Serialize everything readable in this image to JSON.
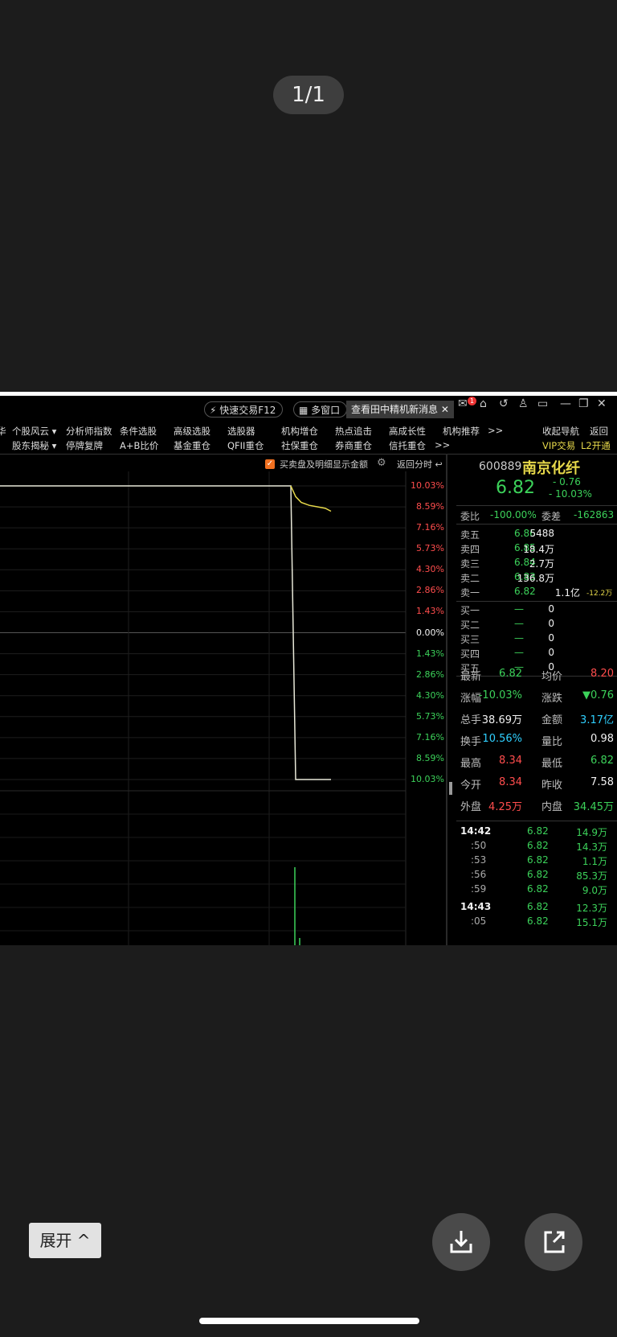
{
  "viewer": {
    "page_counter": "1/1",
    "expand_label": "展开 ^"
  },
  "titlebar": {
    "quick_trade": "快速交易F12",
    "multi_window": "多窗口",
    "tab_label": "查看田中精机新消息",
    "mail_badge": "1"
  },
  "menu": {
    "row1": [
      "个股风云 ▾",
      "分析师指数",
      "条件选股",
      "高级选股",
      "选股器",
      "机构增仓",
      "热点追击",
      "高成长性",
      "机构推荐",
      ">>"
    ],
    "row2": [
      "股东揭秘 ▾",
      "停牌复牌",
      "A+B比价",
      "基金重仓",
      "QFII重仓",
      "社保重仓",
      "券商重仓",
      "信托重仓",
      ">>"
    ],
    "right1": [
      "收起导航",
      "返回"
    ],
    "right2": [
      "VIP交易",
      "L2开通"
    ]
  },
  "chart_header": {
    "checkbox_label": "买卖盘及明细显示金额",
    "back_label": "返回分时"
  },
  "chart_data": {
    "type": "line",
    "ylabel_right": [
      "10.03%",
      "8.59%",
      "7.16%",
      "5.73%",
      "4.30%",
      "2.86%",
      "1.43%",
      "0.00%",
      "1.43%",
      "2.86%",
      "4.30%",
      "5.73%",
      "7.16%",
      "8.59%",
      "10.03%"
    ],
    "ylim_pct": [
      -10.03,
      10.03
    ],
    "price_series_pct": [
      10.03,
      10.03,
      10.03,
      10.03,
      10.03,
      10.03,
      10.03,
      10.03,
      10.03,
      10.03,
      10.03,
      10.03,
      10.03,
      -10.03,
      -10.03,
      -10.03
    ],
    "avg_series_pct": [
      10.03,
      9.3,
      8.9,
      8.7,
      8.6,
      8.5,
      8.3
    ]
  },
  "quote": {
    "code": "600889",
    "name": "南京化纤",
    "price": "6.82",
    "change": "- 0.76",
    "change_pct": "- 10.03%",
    "weibi_label": "委比",
    "weibi": "-100.00%",
    "weicha_label": "委差",
    "weicha": "-162863",
    "asks": [
      {
        "label": "卖五",
        "price": "6.86",
        "vol": "5488"
      },
      {
        "label": "卖四",
        "price": "6.85",
        "vol": "18.4万"
      },
      {
        "label": "卖三",
        "price": "6.84",
        "vol": "2.7万"
      },
      {
        "label": "卖二",
        "price": "6.83",
        "vol": "136.8万"
      },
      {
        "label": "卖一",
        "price": "6.82",
        "vol": "1.1亿",
        "extra": "-12.2万"
      }
    ],
    "bids": [
      {
        "label": "买一",
        "price": "—",
        "vol": "0"
      },
      {
        "label": "买二",
        "price": "—",
        "vol": "0"
      },
      {
        "label": "买三",
        "price": "—",
        "vol": "0"
      },
      {
        "label": "买四",
        "price": "—",
        "vol": "0"
      },
      {
        "label": "买五",
        "price": "—",
        "vol": "0"
      }
    ],
    "stats": [
      {
        "l1": "最新",
        "v1": "6.82",
        "c1": "green",
        "l2": "均价",
        "v2": "8.20",
        "c2": "red"
      },
      {
        "l1": "涨幅",
        "v1": "-10.03%",
        "c1": "green",
        "l2": "涨跌",
        "v2": "▼0.76",
        "c2": "green"
      },
      {
        "l1": "总手",
        "v1": "38.69万",
        "c1": "white",
        "l2": "金额",
        "v2": "3.17亿",
        "c2": "cyan"
      },
      {
        "l1": "换手",
        "v1": "10.56%",
        "c1": "cyan",
        "l2": "量比",
        "v2": "0.98",
        "c2": "white"
      },
      {
        "l1": "最高",
        "v1": "8.34",
        "c1": "red",
        "l2": "最低",
        "v2": "6.82",
        "c2": "green"
      },
      {
        "l1": "今开",
        "v1": "8.34",
        "c1": "red",
        "l2": "昨收",
        "v2": "7.58",
        "c2": "white"
      },
      {
        "l1": "外盘",
        "v1": "4.25万",
        "c1": "red",
        "l2": "内盘",
        "v2": "34.45万",
        "c2": "green"
      }
    ],
    "ticks": [
      {
        "time": "14:42",
        "price": "6.82",
        "vol": "14.9万"
      },
      {
        "time": ":50",
        "price": "6.82",
        "vol": "14.3万"
      },
      {
        "time": ":53",
        "price": "6.82",
        "vol": "1.1万"
      },
      {
        "time": ":56",
        "price": "6.82",
        "vol": "85.3万"
      },
      {
        "time": ":59",
        "price": "6.82",
        "vol": "9.0万"
      },
      {
        "time": "14:43",
        "price": "6.82",
        "vol": "12.3万"
      },
      {
        "time": ":05",
        "price": "6.82",
        "vol": "15.1万"
      }
    ]
  },
  "colors": {
    "up": "#ff4d4d",
    "down": "#3cd25a",
    "price_line": "#e8e8d8",
    "avg_line": "#e6d84a"
  }
}
